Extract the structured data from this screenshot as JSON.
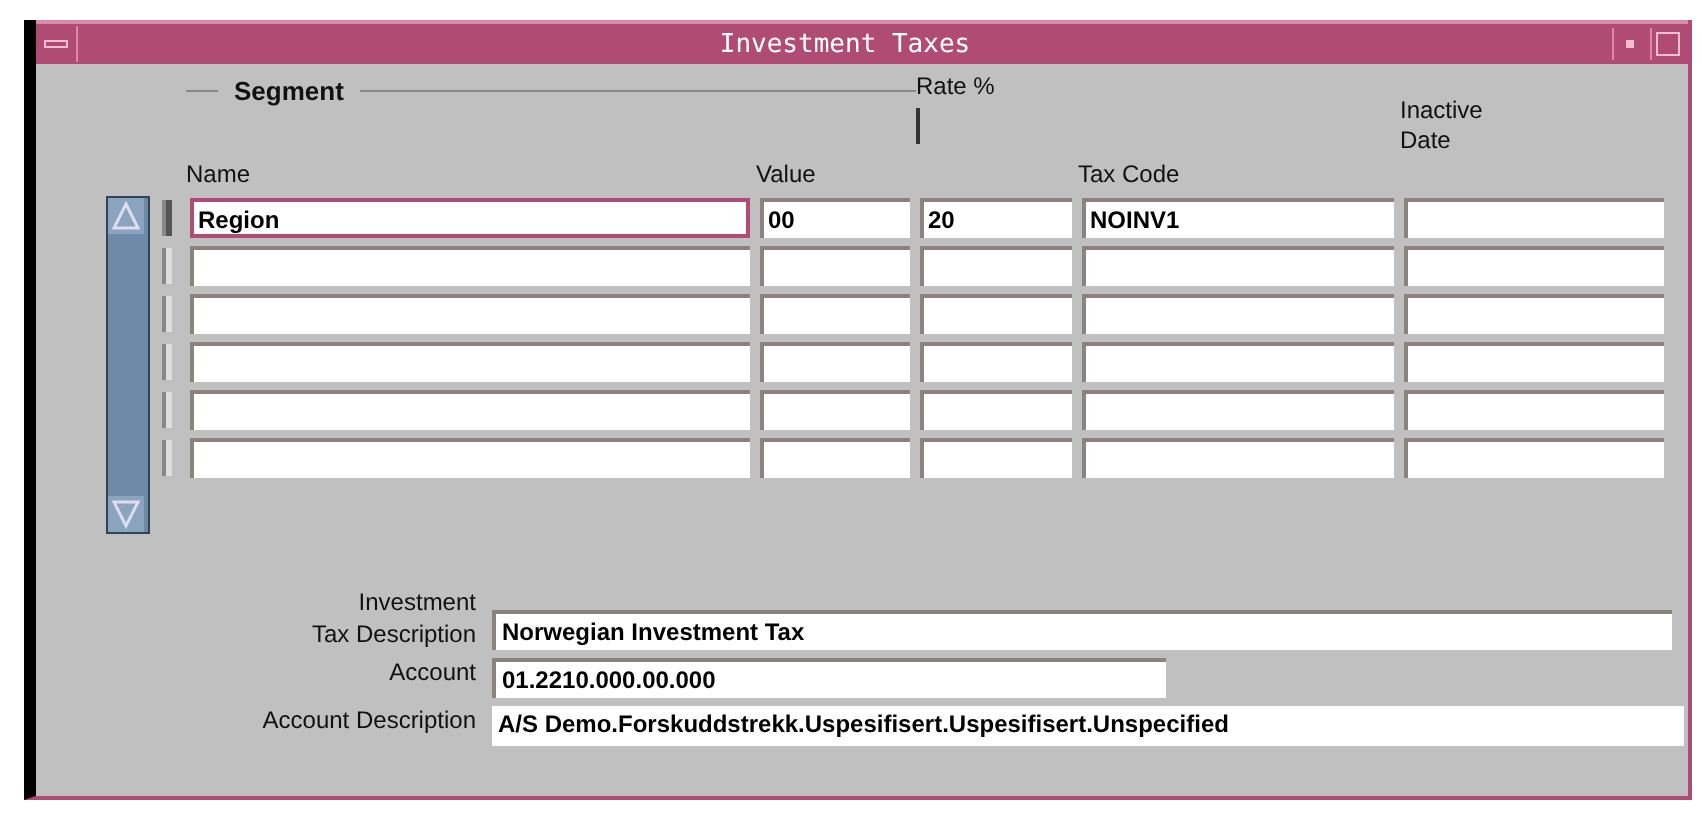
{
  "window": {
    "title": "Investment Taxes"
  },
  "segment": {
    "group_label": "Segment",
    "name_header": "Name",
    "value_header": "Value"
  },
  "columns": {
    "rate": "Rate %",
    "tax_code": "Tax Code",
    "inactive_date": [
      "Inactive",
      "Date"
    ]
  },
  "rows": [
    {
      "selected": true,
      "name": "Region",
      "value": "00",
      "rate": "20",
      "tax_code": "NOINV1"
    },
    {
      "selected": false
    },
    {
      "selected": false
    },
    {
      "selected": false
    },
    {
      "selected": false
    },
    {
      "selected": false
    }
  ],
  "details": {
    "tax_description_label": [
      "Investment",
      "Tax Description"
    ],
    "tax_description": "Norwegian Investment Tax",
    "account_label": "Account",
    "account": "01.2210.000.00.000",
    "account_description_label": "Account Description",
    "account_description": "A/S Demo.Forskuddstrekk.Uspesifisert.Uspesifisert.Unspecified"
  }
}
